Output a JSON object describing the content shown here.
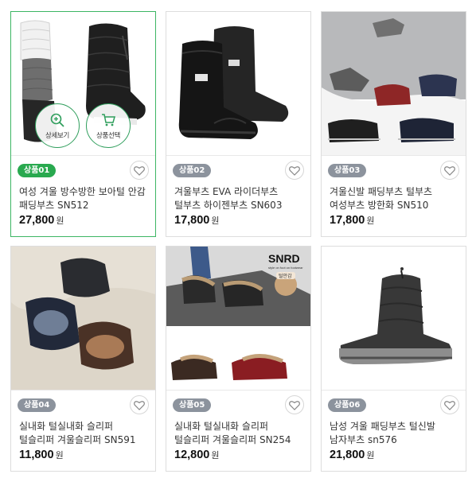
{
  "products": [
    {
      "badge": "상품01",
      "name": "여성 겨울 방수방한 보아털 안감 패딩부츠 SN512",
      "price": "27,800",
      "won": "원"
    },
    {
      "badge": "상품02",
      "name": "겨울부츠 EVA 라이더부츠 털부츠 하이젠부츠 SN603",
      "price": "17,800",
      "won": "원"
    },
    {
      "badge": "상품03",
      "name": "겨울신발 패딩부츠 털부츠 여성부츠 방한화 SN510",
      "price": "17,800",
      "won": "원"
    },
    {
      "badge": "상품04",
      "name": "실내화 털실내화 슬리퍼 털슬리퍼 겨울슬리퍼 SN591",
      "price": "11,800",
      "won": "원"
    },
    {
      "badge": "상품05",
      "name": "실내화 털실내화 슬리퍼 털슬리퍼 겨울슬리퍼 SN254",
      "price": "12,800",
      "won": "원"
    },
    {
      "badge": "상품06",
      "name": "남성 겨울 패딩부츠 털신발 남자부츠 sn576",
      "price": "21,800",
      "won": "원"
    }
  ],
  "hover_actions": {
    "detail_label": "상세보기",
    "select_label": "상품선택"
  },
  "image_text": {
    "brand": "SNRD",
    "brand_sub": "style on foot on footwear",
    "tag": "털안감"
  },
  "colors": {
    "accent": "#29a94f",
    "badge_gray": "#8c939d",
    "active_border": "#3cb563"
  }
}
